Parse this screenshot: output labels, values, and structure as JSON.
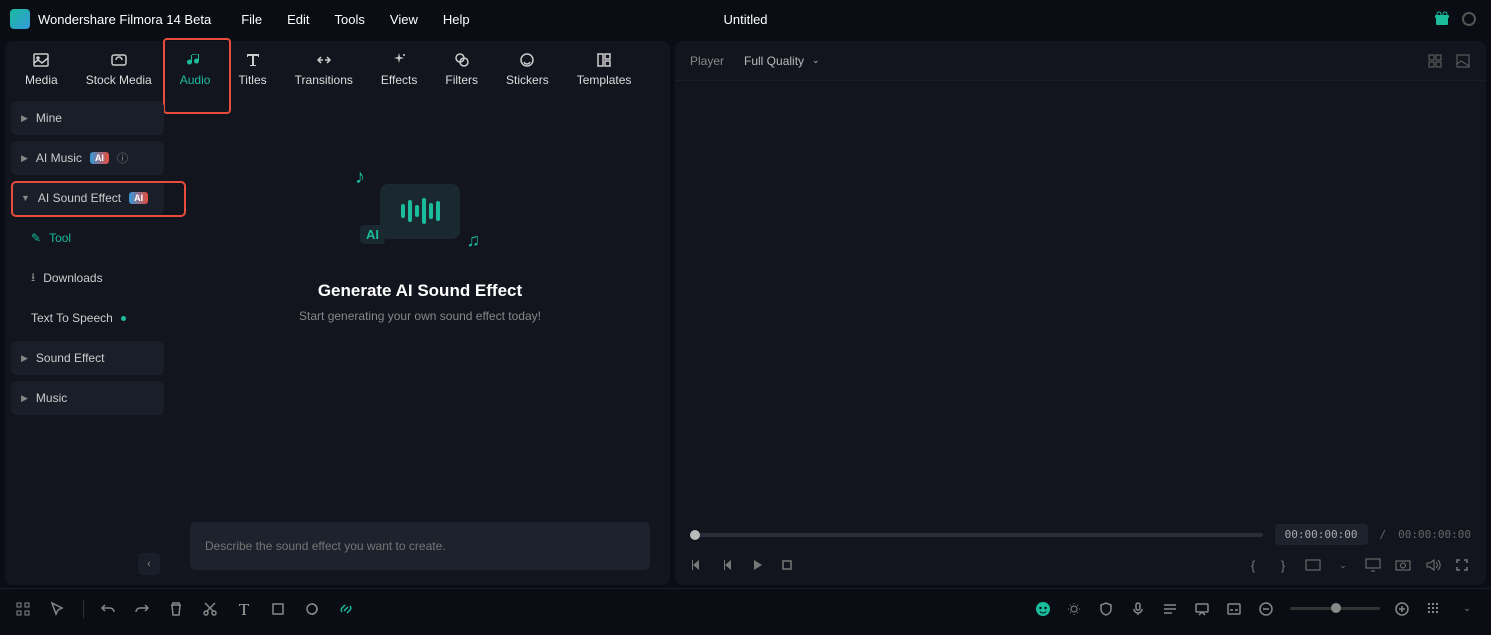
{
  "app": {
    "title": "Wondershare Filmora 14 Beta",
    "document": "Untitled"
  },
  "menu": {
    "file": "File",
    "edit": "Edit",
    "tools": "Tools",
    "view": "View",
    "help": "Help"
  },
  "tabs": {
    "media": "Media",
    "stock_media": "Stock Media",
    "audio": "Audio",
    "titles": "Titles",
    "transitions": "Transitions",
    "effects": "Effects",
    "filters": "Filters",
    "stickers": "Stickers",
    "templates": "Templates"
  },
  "sidebar": {
    "mine": "Mine",
    "ai_music": "AI Music",
    "ai_sound_effect": "AI Sound Effect",
    "tool": "Tool",
    "downloads": "Downloads",
    "text_to_speech": "Text To Speech",
    "sound_effect": "Sound Effect",
    "music": "Music",
    "ai_badge": "AI"
  },
  "content": {
    "title": "Generate AI Sound Effect",
    "subtitle": "Start generating your own sound effect today!",
    "prompt_placeholder": "Describe the sound effect you want to create."
  },
  "player": {
    "label": "Player",
    "quality": "Full Quality",
    "current_time": "00:00:00:00",
    "duration": "00:00:00:00",
    "separator": "/"
  },
  "icons": {
    "ai_text": "AI"
  }
}
